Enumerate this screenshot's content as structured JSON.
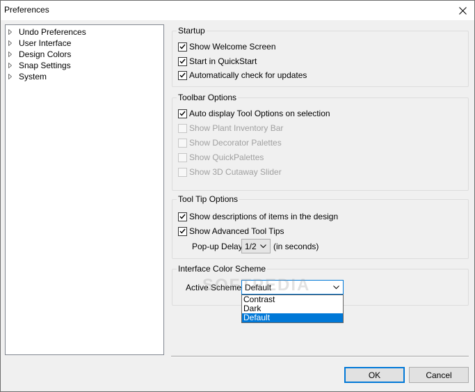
{
  "window": {
    "title": "Preferences"
  },
  "tree": {
    "items": [
      {
        "label": "Undo Preferences"
      },
      {
        "label": "User Interface"
      },
      {
        "label": "Design Colors"
      },
      {
        "label": "Snap Settings"
      },
      {
        "label": "System"
      }
    ]
  },
  "startup": {
    "title": "Startup",
    "options": [
      {
        "label": "Show Welcome Screen",
        "checked": true,
        "enabled": true
      },
      {
        "label": "Start in QuickStart",
        "checked": true,
        "enabled": true
      },
      {
        "label": "Automatically check for updates",
        "checked": true,
        "enabled": true
      }
    ]
  },
  "toolbar_options": {
    "title": "Toolbar Options",
    "options": [
      {
        "label": "Auto display Tool Options on selection",
        "checked": true,
        "enabled": true
      },
      {
        "label": "Show Plant Inventory Bar",
        "checked": false,
        "enabled": false
      },
      {
        "label": "Show Decorator Palettes",
        "checked": false,
        "enabled": false
      },
      {
        "label": "Show QuickPalettes",
        "checked": false,
        "enabled": false
      },
      {
        "label": "Show 3D Cutaway Slider",
        "checked": false,
        "enabled": false
      }
    ]
  },
  "tooltip_options": {
    "title": "Tool Tip Options",
    "options": [
      {
        "label": "Show descriptions of items in the design",
        "checked": true,
        "enabled": true
      },
      {
        "label": "Show Advanced Tool Tips",
        "checked": true,
        "enabled": true
      }
    ],
    "delay_label": "Pop-up Delay:",
    "delay_value": "1/2",
    "delay_unit": "(in seconds)"
  },
  "color_scheme": {
    "title": "Interface Color Scheme",
    "label": "Active Scheme:",
    "value": "Default",
    "options": [
      "Contrast",
      "Dark",
      "Default"
    ],
    "selected_index": 2
  },
  "buttons": {
    "ok": "OK",
    "cancel": "Cancel"
  },
  "watermark": "SOFTPEDIA",
  "colors": {
    "accent": "#0078d7",
    "disabled_text": "#a0a0a0"
  }
}
